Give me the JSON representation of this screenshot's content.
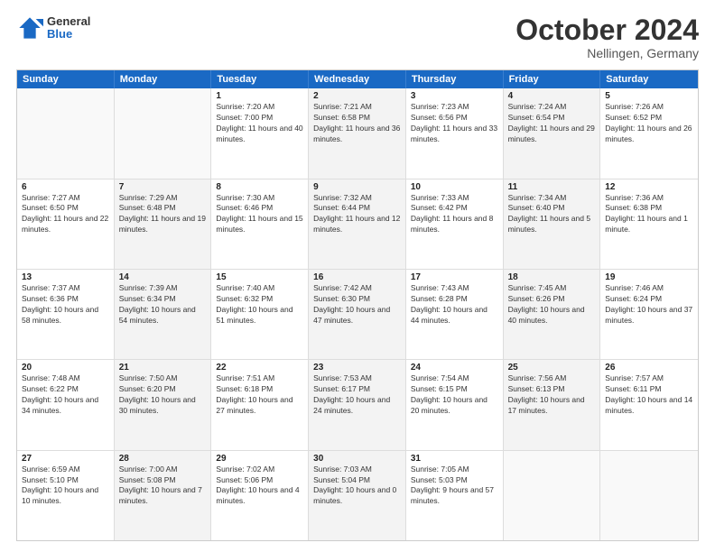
{
  "header": {
    "logo_general": "General",
    "logo_blue": "Blue",
    "month_title": "October 2024",
    "location": "Nellingen, Germany"
  },
  "days_of_week": [
    "Sunday",
    "Monday",
    "Tuesday",
    "Wednesday",
    "Thursday",
    "Friday",
    "Saturday"
  ],
  "weeks": [
    [
      {
        "day": "",
        "sunrise": "",
        "sunset": "",
        "daylight": "",
        "shaded": false,
        "empty": true
      },
      {
        "day": "",
        "sunrise": "",
        "sunset": "",
        "daylight": "",
        "shaded": false,
        "empty": true
      },
      {
        "day": "1",
        "sunrise": "Sunrise: 7:20 AM",
        "sunset": "Sunset: 7:00 PM",
        "daylight": "Daylight: 11 hours and 40 minutes.",
        "shaded": false,
        "empty": false
      },
      {
        "day": "2",
        "sunrise": "Sunrise: 7:21 AM",
        "sunset": "Sunset: 6:58 PM",
        "daylight": "Daylight: 11 hours and 36 minutes.",
        "shaded": true,
        "empty": false
      },
      {
        "day": "3",
        "sunrise": "Sunrise: 7:23 AM",
        "sunset": "Sunset: 6:56 PM",
        "daylight": "Daylight: 11 hours and 33 minutes.",
        "shaded": false,
        "empty": false
      },
      {
        "day": "4",
        "sunrise": "Sunrise: 7:24 AM",
        "sunset": "Sunset: 6:54 PM",
        "daylight": "Daylight: 11 hours and 29 minutes.",
        "shaded": true,
        "empty": false
      },
      {
        "day": "5",
        "sunrise": "Sunrise: 7:26 AM",
        "sunset": "Sunset: 6:52 PM",
        "daylight": "Daylight: 11 hours and 26 minutes.",
        "shaded": false,
        "empty": false
      }
    ],
    [
      {
        "day": "6",
        "sunrise": "Sunrise: 7:27 AM",
        "sunset": "Sunset: 6:50 PM",
        "daylight": "Daylight: 11 hours and 22 minutes.",
        "shaded": false,
        "empty": false
      },
      {
        "day": "7",
        "sunrise": "Sunrise: 7:29 AM",
        "sunset": "Sunset: 6:48 PM",
        "daylight": "Daylight: 11 hours and 19 minutes.",
        "shaded": true,
        "empty": false
      },
      {
        "day": "8",
        "sunrise": "Sunrise: 7:30 AM",
        "sunset": "Sunset: 6:46 PM",
        "daylight": "Daylight: 11 hours and 15 minutes.",
        "shaded": false,
        "empty": false
      },
      {
        "day": "9",
        "sunrise": "Sunrise: 7:32 AM",
        "sunset": "Sunset: 6:44 PM",
        "daylight": "Daylight: 11 hours and 12 minutes.",
        "shaded": true,
        "empty": false
      },
      {
        "day": "10",
        "sunrise": "Sunrise: 7:33 AM",
        "sunset": "Sunset: 6:42 PM",
        "daylight": "Daylight: 11 hours and 8 minutes.",
        "shaded": false,
        "empty": false
      },
      {
        "day": "11",
        "sunrise": "Sunrise: 7:34 AM",
        "sunset": "Sunset: 6:40 PM",
        "daylight": "Daylight: 11 hours and 5 minutes.",
        "shaded": true,
        "empty": false
      },
      {
        "day": "12",
        "sunrise": "Sunrise: 7:36 AM",
        "sunset": "Sunset: 6:38 PM",
        "daylight": "Daylight: 11 hours and 1 minute.",
        "shaded": false,
        "empty": false
      }
    ],
    [
      {
        "day": "13",
        "sunrise": "Sunrise: 7:37 AM",
        "sunset": "Sunset: 6:36 PM",
        "daylight": "Daylight: 10 hours and 58 minutes.",
        "shaded": false,
        "empty": false
      },
      {
        "day": "14",
        "sunrise": "Sunrise: 7:39 AM",
        "sunset": "Sunset: 6:34 PM",
        "daylight": "Daylight: 10 hours and 54 minutes.",
        "shaded": true,
        "empty": false
      },
      {
        "day": "15",
        "sunrise": "Sunrise: 7:40 AM",
        "sunset": "Sunset: 6:32 PM",
        "daylight": "Daylight: 10 hours and 51 minutes.",
        "shaded": false,
        "empty": false
      },
      {
        "day": "16",
        "sunrise": "Sunrise: 7:42 AM",
        "sunset": "Sunset: 6:30 PM",
        "daylight": "Daylight: 10 hours and 47 minutes.",
        "shaded": true,
        "empty": false
      },
      {
        "day": "17",
        "sunrise": "Sunrise: 7:43 AM",
        "sunset": "Sunset: 6:28 PM",
        "daylight": "Daylight: 10 hours and 44 minutes.",
        "shaded": false,
        "empty": false
      },
      {
        "day": "18",
        "sunrise": "Sunrise: 7:45 AM",
        "sunset": "Sunset: 6:26 PM",
        "daylight": "Daylight: 10 hours and 40 minutes.",
        "shaded": true,
        "empty": false
      },
      {
        "day": "19",
        "sunrise": "Sunrise: 7:46 AM",
        "sunset": "Sunset: 6:24 PM",
        "daylight": "Daylight: 10 hours and 37 minutes.",
        "shaded": false,
        "empty": false
      }
    ],
    [
      {
        "day": "20",
        "sunrise": "Sunrise: 7:48 AM",
        "sunset": "Sunset: 6:22 PM",
        "daylight": "Daylight: 10 hours and 34 minutes.",
        "shaded": false,
        "empty": false
      },
      {
        "day": "21",
        "sunrise": "Sunrise: 7:50 AM",
        "sunset": "Sunset: 6:20 PM",
        "daylight": "Daylight: 10 hours and 30 minutes.",
        "shaded": true,
        "empty": false
      },
      {
        "day": "22",
        "sunrise": "Sunrise: 7:51 AM",
        "sunset": "Sunset: 6:18 PM",
        "daylight": "Daylight: 10 hours and 27 minutes.",
        "shaded": false,
        "empty": false
      },
      {
        "day": "23",
        "sunrise": "Sunrise: 7:53 AM",
        "sunset": "Sunset: 6:17 PM",
        "daylight": "Daylight: 10 hours and 24 minutes.",
        "shaded": true,
        "empty": false
      },
      {
        "day": "24",
        "sunrise": "Sunrise: 7:54 AM",
        "sunset": "Sunset: 6:15 PM",
        "daylight": "Daylight: 10 hours and 20 minutes.",
        "shaded": false,
        "empty": false
      },
      {
        "day": "25",
        "sunrise": "Sunrise: 7:56 AM",
        "sunset": "Sunset: 6:13 PM",
        "daylight": "Daylight: 10 hours and 17 minutes.",
        "shaded": true,
        "empty": false
      },
      {
        "day": "26",
        "sunrise": "Sunrise: 7:57 AM",
        "sunset": "Sunset: 6:11 PM",
        "daylight": "Daylight: 10 hours and 14 minutes.",
        "shaded": false,
        "empty": false
      }
    ],
    [
      {
        "day": "27",
        "sunrise": "Sunrise: 6:59 AM",
        "sunset": "Sunset: 5:10 PM",
        "daylight": "Daylight: 10 hours and 10 minutes.",
        "shaded": false,
        "empty": false
      },
      {
        "day": "28",
        "sunrise": "Sunrise: 7:00 AM",
        "sunset": "Sunset: 5:08 PM",
        "daylight": "Daylight: 10 hours and 7 minutes.",
        "shaded": true,
        "empty": false
      },
      {
        "day": "29",
        "sunrise": "Sunrise: 7:02 AM",
        "sunset": "Sunset: 5:06 PM",
        "daylight": "Daylight: 10 hours and 4 minutes.",
        "shaded": false,
        "empty": false
      },
      {
        "day": "30",
        "sunrise": "Sunrise: 7:03 AM",
        "sunset": "Sunset: 5:04 PM",
        "daylight": "Daylight: 10 hours and 0 minutes.",
        "shaded": true,
        "empty": false
      },
      {
        "day": "31",
        "sunrise": "Sunrise: 7:05 AM",
        "sunset": "Sunset: 5:03 PM",
        "daylight": "Daylight: 9 hours and 57 minutes.",
        "shaded": false,
        "empty": false
      },
      {
        "day": "",
        "sunrise": "",
        "sunset": "",
        "daylight": "",
        "shaded": true,
        "empty": true
      },
      {
        "day": "",
        "sunrise": "",
        "sunset": "",
        "daylight": "",
        "shaded": false,
        "empty": true
      }
    ]
  ]
}
